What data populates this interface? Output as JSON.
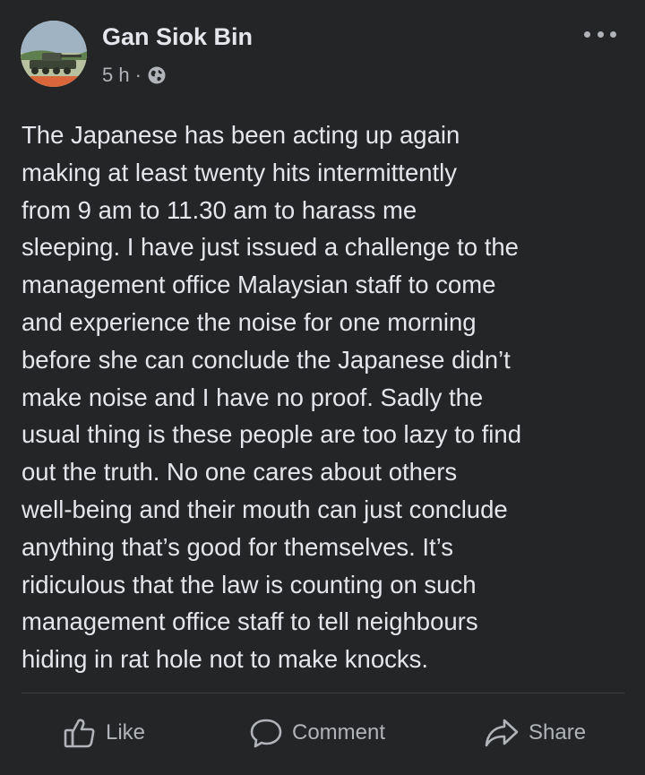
{
  "post": {
    "author": "Gan Siok Bin",
    "time": "5 h",
    "separator": "·",
    "privacy_icon": "globe-icon",
    "more_icon": "more-options-icon",
    "text": "The Japanese has been acting up again\nmaking at least twenty hits intermittently\nfrom 9 am to 11.30 am to harass me\nsleeping. I have just issued a challenge to the\nmanagement office Malaysian staff to come\nand experience the noise for one morning\nbefore she can  conclude the Japanese didn’t\nmake noise and I have no proof. Sadly the\nusual thing is these people are too lazy to find\nout the truth. No one cares about others\nwell-being and their mouth can just conclude\nanything that’s good for themselves. It’s\nridiculous that the law is counting on such\nmanagement office staff to tell neighbours\nhiding in rat hole not to make knocks."
  },
  "actions": {
    "like_label": "Like",
    "comment_label": "Comment",
    "share_label": "Share"
  },
  "colors": {
    "background": "#242526",
    "primary_text": "#e4e6eb",
    "secondary_text": "#b0b3b8",
    "divider": "#3e4042"
  }
}
